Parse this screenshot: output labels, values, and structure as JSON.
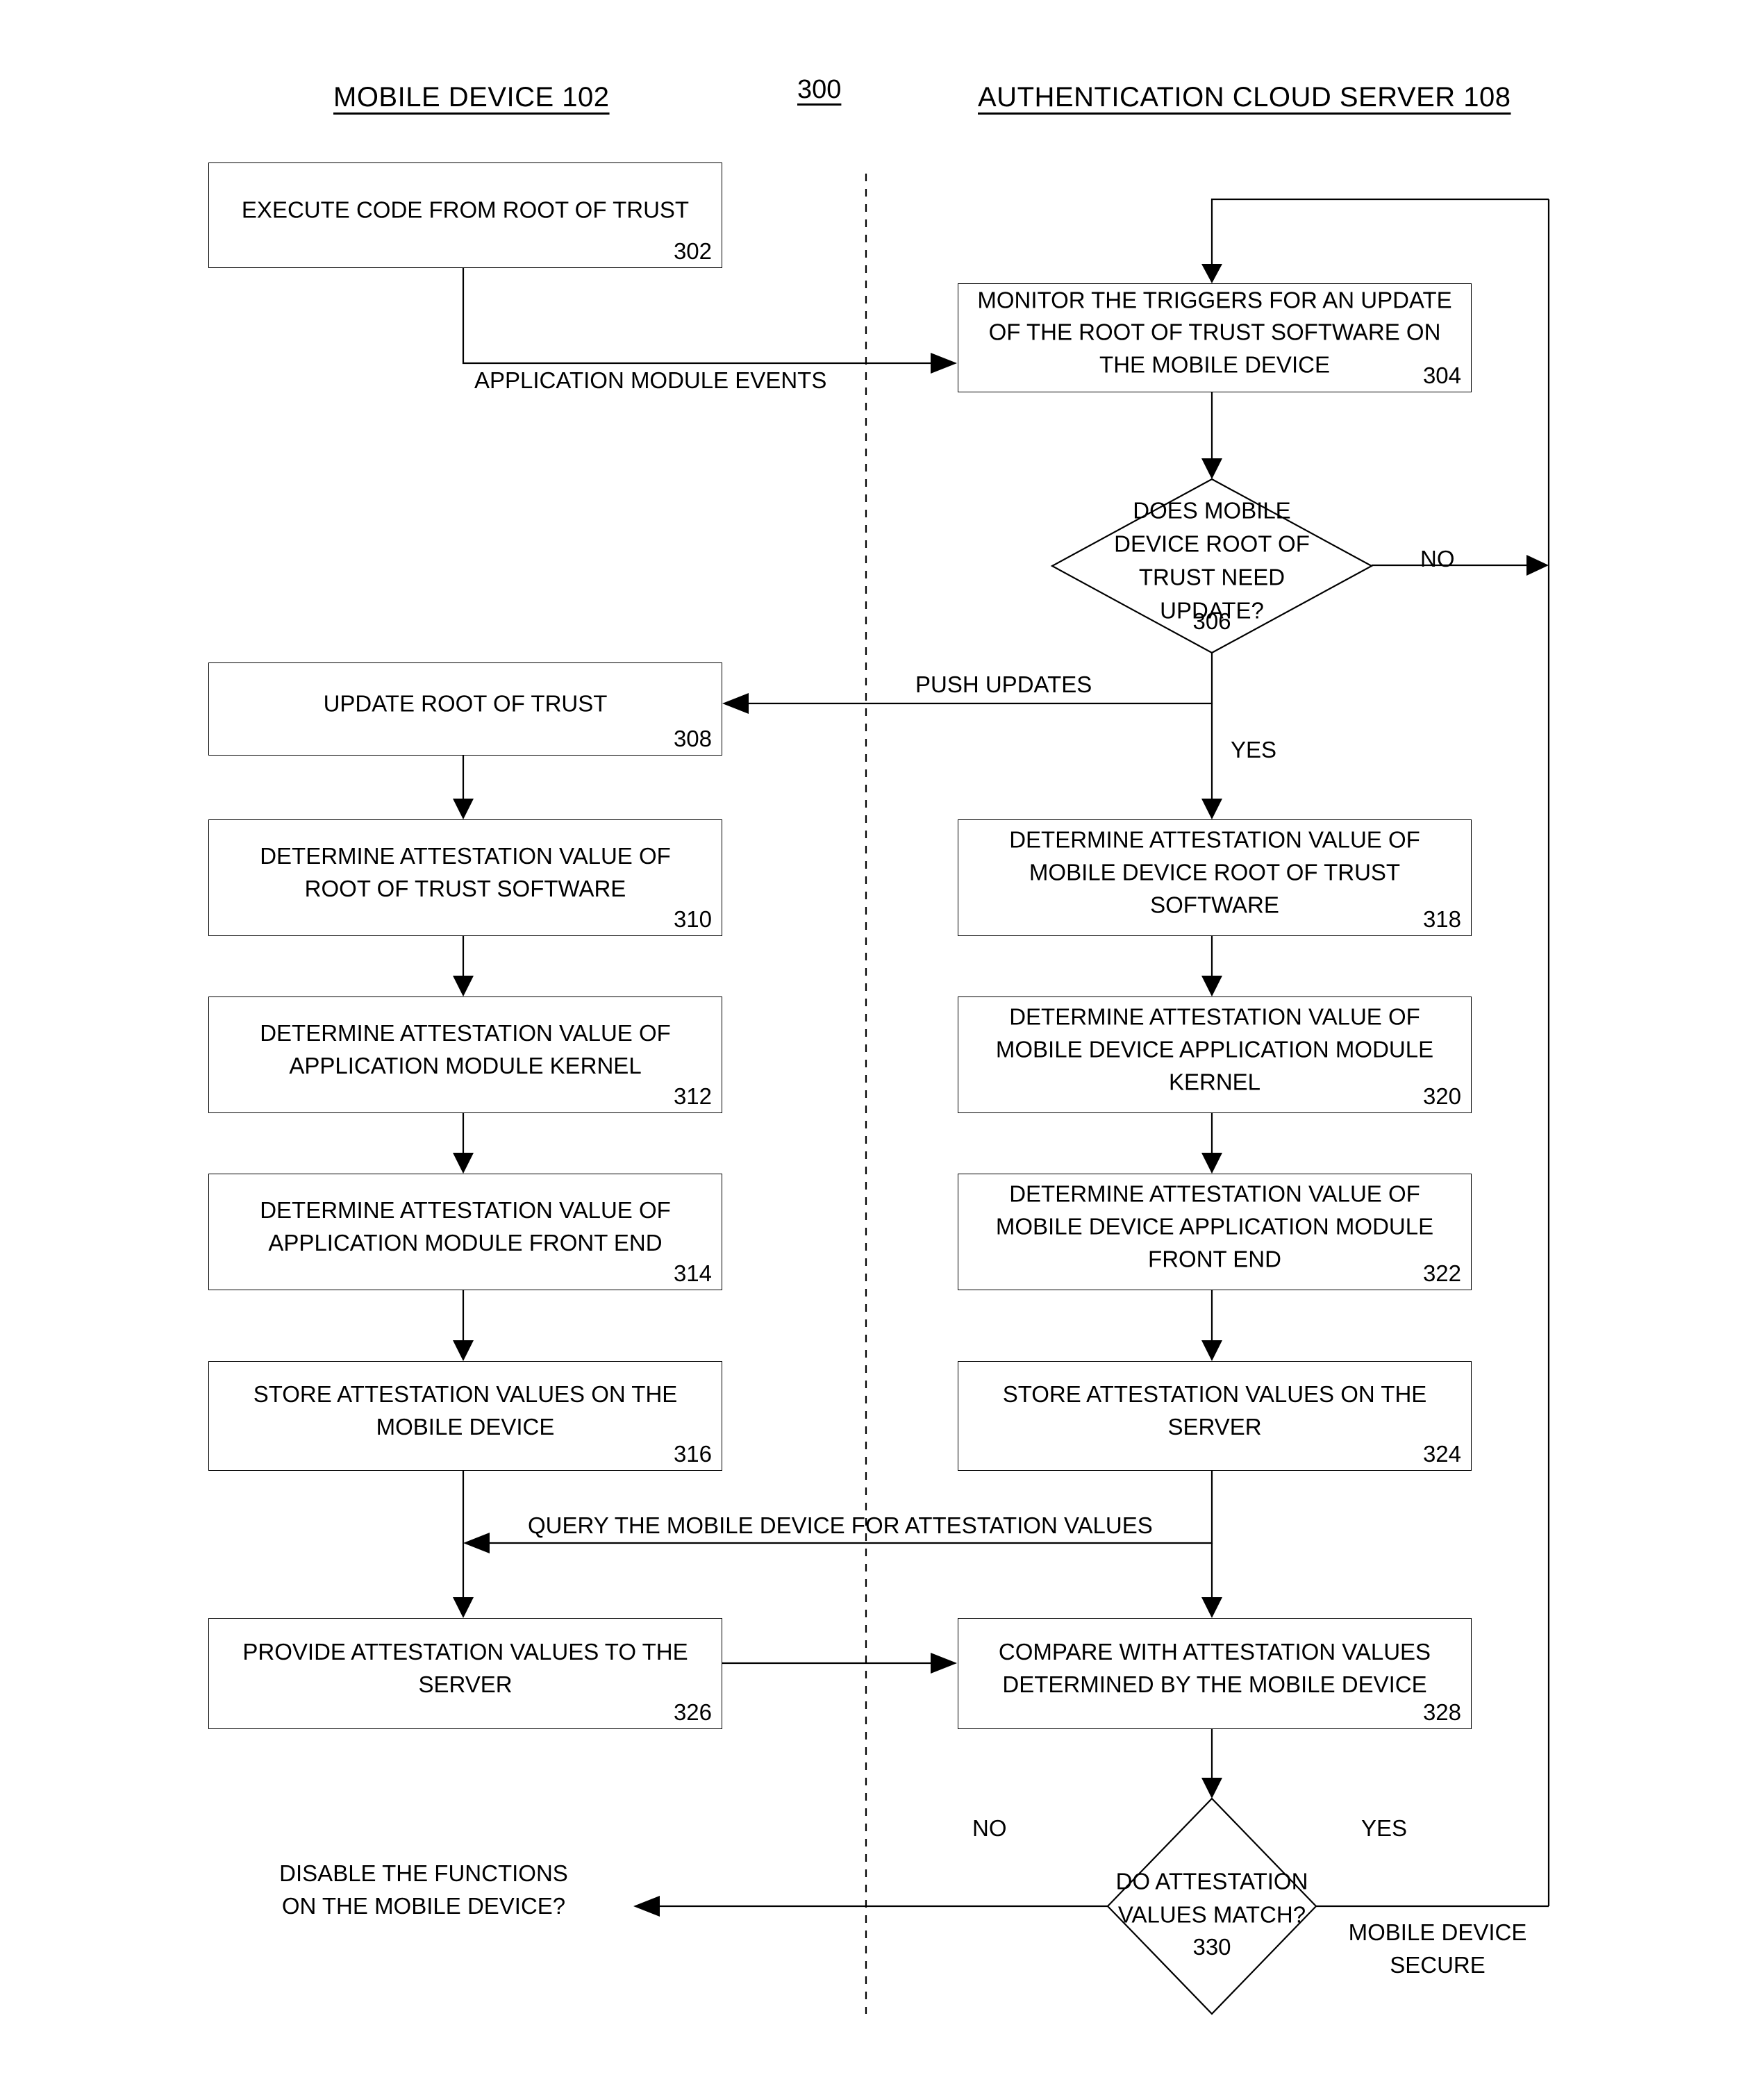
{
  "figure": {
    "number": "300",
    "lane_left_title": "MOBILE DEVICE 102",
    "lane_right_title": "AUTHENTICATION CLOUD SERVER 108"
  },
  "nodes": {
    "n302": {
      "text": "EXECUTE CODE FROM ROOT OF TRUST",
      "num": "302",
      "type": "process",
      "lane": "left"
    },
    "n304": {
      "text": "MONITOR THE TRIGGERS FOR AN UPDATE\nOF THE ROOT OF TRUST SOFTWARE ON\nTHE MOBILE DEVICE",
      "num": "304",
      "type": "process",
      "lane": "right"
    },
    "n306": {
      "text": "DOES MOBILE\nDEVICE ROOT OF\nTRUST NEED\nUPDATE?",
      "num": "306",
      "type": "decision",
      "lane": "right"
    },
    "n308": {
      "text": "UPDATE ROOT OF TRUST",
      "num": "308",
      "type": "process",
      "lane": "left"
    },
    "n310": {
      "text": "DETERMINE ATTESTATION VALUE OF\nROOT OF TRUST SOFTWARE",
      "num": "310",
      "type": "process",
      "lane": "left"
    },
    "n312": {
      "text": "DETERMINE ATTESTATION VALUE OF\nAPPLICATION MODULE KERNEL",
      "num": "312",
      "type": "process",
      "lane": "left"
    },
    "n314": {
      "text": "DETERMINE ATTESTATION VALUE OF\nAPPLICATION MODULE FRONT END",
      "num": "314",
      "type": "process",
      "lane": "left"
    },
    "n316": {
      "text": "STORE ATTESTATION VALUES ON THE\nMOBILE DEVICE",
      "num": "316",
      "type": "process",
      "lane": "left"
    },
    "n318": {
      "text": "DETERMINE ATTESTATION VALUE OF\nMOBILE DEVICE ROOT OF TRUST\nSOFTWARE",
      "num": "318",
      "type": "process",
      "lane": "right"
    },
    "n320": {
      "text": "DETERMINE ATTESTATION VALUE OF\nMOBILE DEVICE APPLICATION MODULE\nKERNEL",
      "num": "320",
      "type": "process",
      "lane": "right"
    },
    "n322": {
      "text": "DETERMINE ATTESTATION VALUE OF\nMOBILE DEVICE APPLICATION MODULE\nFRONT END",
      "num": "322",
      "type": "process",
      "lane": "right"
    },
    "n324": {
      "text": "STORE ATTESTATION VALUES ON THE\nSERVER",
      "num": "324",
      "type": "process",
      "lane": "right"
    },
    "n326": {
      "text": "PROVIDE ATTESTATION VALUES TO THE\nSERVER",
      "num": "326",
      "type": "process",
      "lane": "left"
    },
    "n328": {
      "text": "COMPARE WITH ATTESTATION VALUES\nDETERMINED BY THE MOBILE DEVICE",
      "num": "328",
      "type": "process",
      "lane": "right"
    },
    "n330": {
      "text": "DO ATTESTATION\nVALUES MATCH?",
      "num": "330",
      "type": "decision",
      "lane": "right"
    }
  },
  "edge_labels": {
    "application_module_events": "APPLICATION MODULE EVENTS",
    "push_updates": "PUSH UPDATES",
    "query_mobile_device": "QUERY THE MOBILE DEVICE FOR ATTESTATION VALUES",
    "no_306": "NO",
    "yes_306": "YES",
    "no_330": "NO",
    "yes_330": "YES",
    "mobile_device_secure": "MOBILE DEVICE\nSECURE",
    "disable_functions": "DISABLE THE FUNCTIONS\nON THE MOBILE DEVICE?"
  }
}
